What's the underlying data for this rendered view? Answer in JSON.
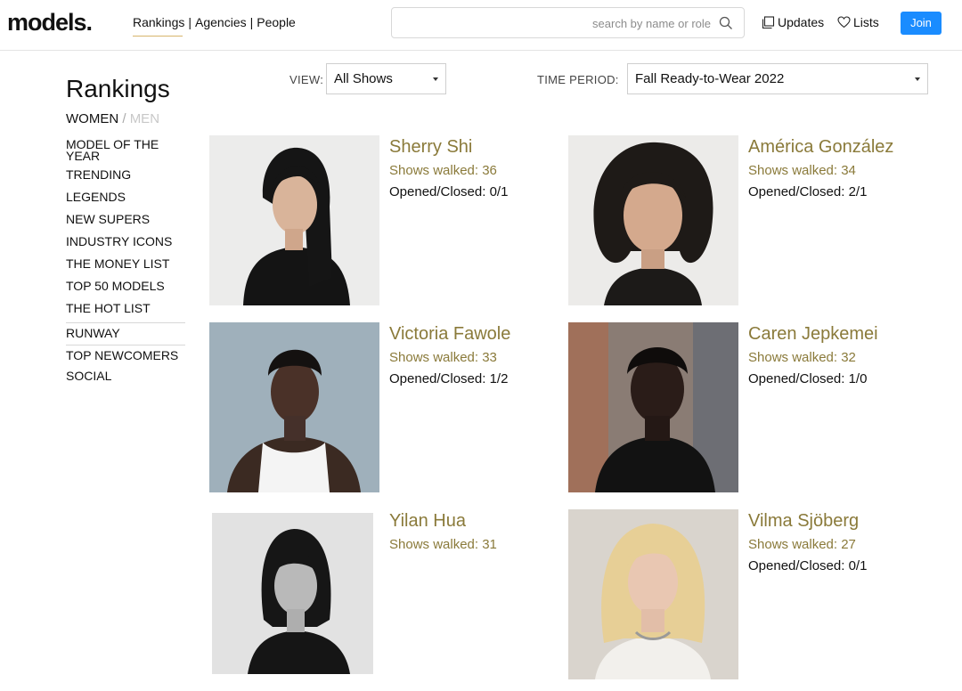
{
  "header": {
    "logo": "models.",
    "nav": [
      "Rankings",
      "Agencies",
      "People"
    ],
    "nav_separator": "|",
    "search_placeholder": "search by name or role",
    "updates_label": "Updates",
    "lists_label": "Lists",
    "join_label": "Join"
  },
  "filters": {
    "view_label": "VIEW:",
    "view_value": "All Shows",
    "period_label": "TIME PERIOD:",
    "period_value": "Fall Ready-to-Wear 2022"
  },
  "sidebar": {
    "title": "Rankings",
    "women": "WOMEN",
    "slash": " / ",
    "men": "MEN",
    "items": [
      "MODEL OF THE YEAR",
      "TRENDING",
      "LEGENDS",
      "NEW SUPERS",
      "INDUSTRY ICONS",
      "THE MONEY LIST",
      "TOP 50 MODELS",
      "THE HOT LIST",
      "RUNWAY",
      "TOP NEWCOMERS",
      "SOCIAL"
    ]
  },
  "models": [
    {
      "name": "Sherry Shi",
      "shows": "Shows walked: 36",
      "opened_closed": "Opened/Closed: 0/1"
    },
    {
      "name": "América González",
      "shows": "Shows walked: 34",
      "opened_closed": "Opened/Closed: 2/1"
    },
    {
      "name": "Victoria Fawole",
      "shows": "Shows walked: 33",
      "opened_closed": "Opened/Closed: 1/2"
    },
    {
      "name": "Caren Jepkemei",
      "shows": "Shows walked: 32",
      "opened_closed": "Opened/Closed: 1/0"
    },
    {
      "name": "Yilan Hua",
      "shows": "Shows walked: 31",
      "opened_closed": ""
    },
    {
      "name": "Vilma Sjöberg",
      "shows": "Shows walked: 27",
      "opened_closed": "Opened/Closed: 0/1"
    }
  ],
  "colors": {
    "accent_gold": "#8a7a3a",
    "join_blue": "#1a8cff",
    "nav_underline": "#d7b56b"
  }
}
